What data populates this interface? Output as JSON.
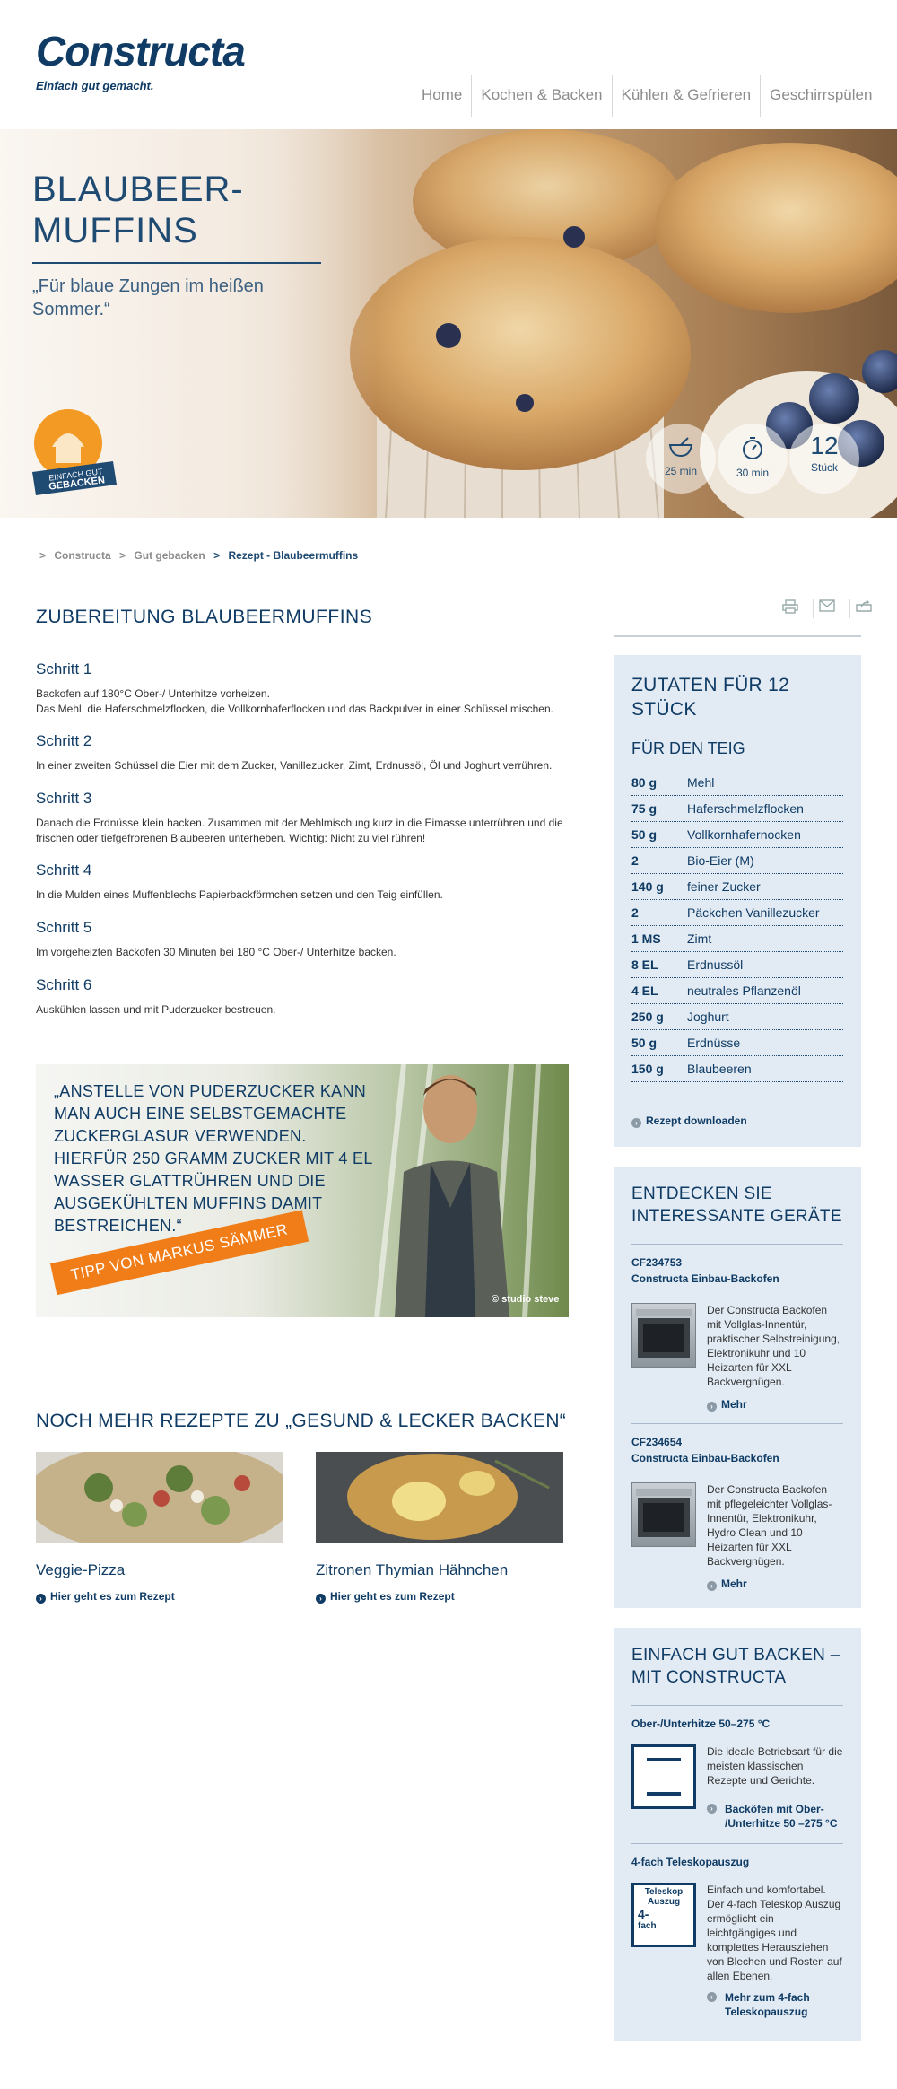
{
  "header": {
    "logo": "Constructa",
    "slogan": "Einfach gut gemacht.",
    "nav": [
      "Home",
      "Kochen & Backen",
      "Kühlen & Gefrieren",
      "Geschirrspülen"
    ]
  },
  "hero": {
    "title_line1": "BLAUBEER-",
    "title_line2": "MUFFINS",
    "subtitle": "„Für blaue Zungen im heißen Sommer.“",
    "badge_line1": "EINFACH GUT",
    "badge_line2": "GEBACKEN",
    "stats": [
      {
        "icon": "bowl-icon",
        "label": "25 min"
      },
      {
        "icon": "stopwatch-icon",
        "label": "30 min"
      },
      {
        "icon": "count",
        "value": "12",
        "label": "Stück"
      }
    ]
  },
  "breadcrumb": {
    "items": [
      "Constructa",
      "Gut gebacken"
    ],
    "current": "Rezept - Blaubeermuffins"
  },
  "main": {
    "title": "ZUBEREITUNG BLAUBEERMUFFINS",
    "steps": [
      {
        "heading": "Schritt 1",
        "text_line1": "Backofen auf 180°C Ober-/ Unterhitze vorheizen.",
        "text_line2": "Das Mehl, die Haferschmelzflocken, die Vollkornhaferflocken und das Backpulver in einer Schüssel mischen."
      },
      {
        "heading": "Schritt 2",
        "text_line1": "In einer zweiten Schüssel die Eier mit dem Zucker, Vanillezucker, Zimt, Erdnussöl, Öl und Joghurt verrühren.",
        "text_line2": ""
      },
      {
        "heading": "Schritt 3",
        "text_line1": "Danach die Erdnüsse klein hacken. Zusammen mit der Mehlmischung kurz in die Eimasse unterrühren und die",
        "text_line2": "frischen oder tiefgefrorenen Blaubeeren unterheben. Wichtig: Nicht zu viel rühren!"
      },
      {
        "heading": "Schritt 4",
        "text_line1": "In die Mulden eines Muffenblechs Papierbackförmchen setzen und den Teig einfüllen.",
        "text_line2": ""
      },
      {
        "heading": "Schritt 5",
        "text_line1": "Im vorgeheizten Backofen 30 Minuten bei 180 °C Ober-/ Unterhitze backen.",
        "text_line2": ""
      },
      {
        "heading": "Schritt 6",
        "text_line1": "Auskühlen lassen und mit Puderzucker bestreuen.",
        "text_line2": ""
      }
    ],
    "tip": {
      "lines": [
        "„ANSTELLE VON PUDERZUCKER KANN",
        "MAN AUCH EINE SELBSTGEMACHTE",
        "ZUCKERGLASUR VERWENDEN.",
        "HIERFÜR 250 GRAMM ZUCKER MIT 4 EL",
        "WASSER GLATTRÜHREN UND DIE",
        "AUSGEKÜHLTEN MUFFINS DAMIT",
        "BESTREICHEN.“"
      ],
      "ribbon": "TIPP VON MARKUS SÄMMER",
      "credit": "© studio steve"
    },
    "more": {
      "title": "NOCH MEHR REZEPTE ZU „GESUND & LECKER BACKEN“",
      "recipes": [
        {
          "name": "Veggie-Pizza",
          "link": "Hier geht es zum Rezept"
        },
        {
          "name": "Zitronen Thymian Hähnchen",
          "link": "Hier geht es zum Rezept"
        }
      ]
    }
  },
  "ingredients": {
    "title_line1": "ZUTATEN FÜR 12",
    "title_line2": "STÜCK",
    "subtitle": "FÜR DEN TEIG",
    "items": [
      {
        "amount": "80 g",
        "name": "Mehl"
      },
      {
        "amount": "75 g",
        "name": "Haferschmelzflocken"
      },
      {
        "amount": "50 g",
        "name": "Vollkornhafernocken"
      },
      {
        "amount": "2",
        "name": "Bio-Eier (M)"
      },
      {
        "amount": "140 g",
        "name": "feiner Zucker"
      },
      {
        "amount": "2",
        "name": "Päckchen Vanillezucker"
      },
      {
        "amount": "1 MS",
        "name": "Zimt"
      },
      {
        "amount": "8 EL",
        "name": "Erdnussöl"
      },
      {
        "amount": "4 EL",
        "name": "neutrales Pflanzenöl"
      },
      {
        "amount": "250 g",
        "name": "Joghurt"
      },
      {
        "amount": "50 g",
        "name": "Erdnüsse"
      },
      {
        "amount": "150 g",
        "name": "Blaubeeren"
      }
    ],
    "download": "Rezept downloaden"
  },
  "devices": {
    "title_line1": "ENTDECKEN SIE",
    "title_line2": "INTERESSANTE GERÄTE",
    "items": [
      {
        "code": "CF234753",
        "name": "Constructa Einbau-Backofen",
        "desc": [
          "Der Constructa Backofen",
          "mit Vollglas-Innentür,",
          "praktischer Selbstreinigung,",
          "Elektronikuhr und 10",
          "Heizarten für XXL",
          "Backvergnügen."
        ],
        "more": "Mehr"
      },
      {
        "code": "CF234654",
        "name": "Constructa Einbau-Backofen",
        "desc": [
          "Der Constructa Backofen",
          "mit pflegeleichter Vollglas-",
          "Innentür, Elektronikuhr,",
          "Hydro Clean und 10",
          "Heizarten für XXL",
          "Backvergnügen."
        ],
        "more": "Mehr"
      }
    ]
  },
  "features": {
    "title_line1": "EINFACH GUT BACKEN –",
    "title_line2": "MIT CONSTRUCTA",
    "items": [
      {
        "heading": "Ober-/Unterhitze 50–275 °C",
        "desc": [
          "Die ideale Betriebsart für die",
          "meisten klassischen",
          "Rezepte und Gerichte."
        ],
        "link_line1": "Backöfen mit Ober-",
        "link_line2": "/Unterhitze 50 –275 °C"
      },
      {
        "heading": "4-fach Teleskopauszug",
        "icon_text1": "Teleskop",
        "icon_text2": "Auszug",
        "icon_text3": "4-",
        "icon_text4": "fach",
        "desc": [
          "Einfach und komfortabel.",
          "Der 4-fach Teleskop Auszug",
          "ermöglicht ein",
          "leichtgängiges und",
          "komplettes Herausziehen",
          "von Blechen und Rosten auf",
          "allen Ebenen."
        ],
        "link_line1": "Mehr zum 4-fach",
        "link_line2": "Teleskopauszug"
      }
    ]
  }
}
